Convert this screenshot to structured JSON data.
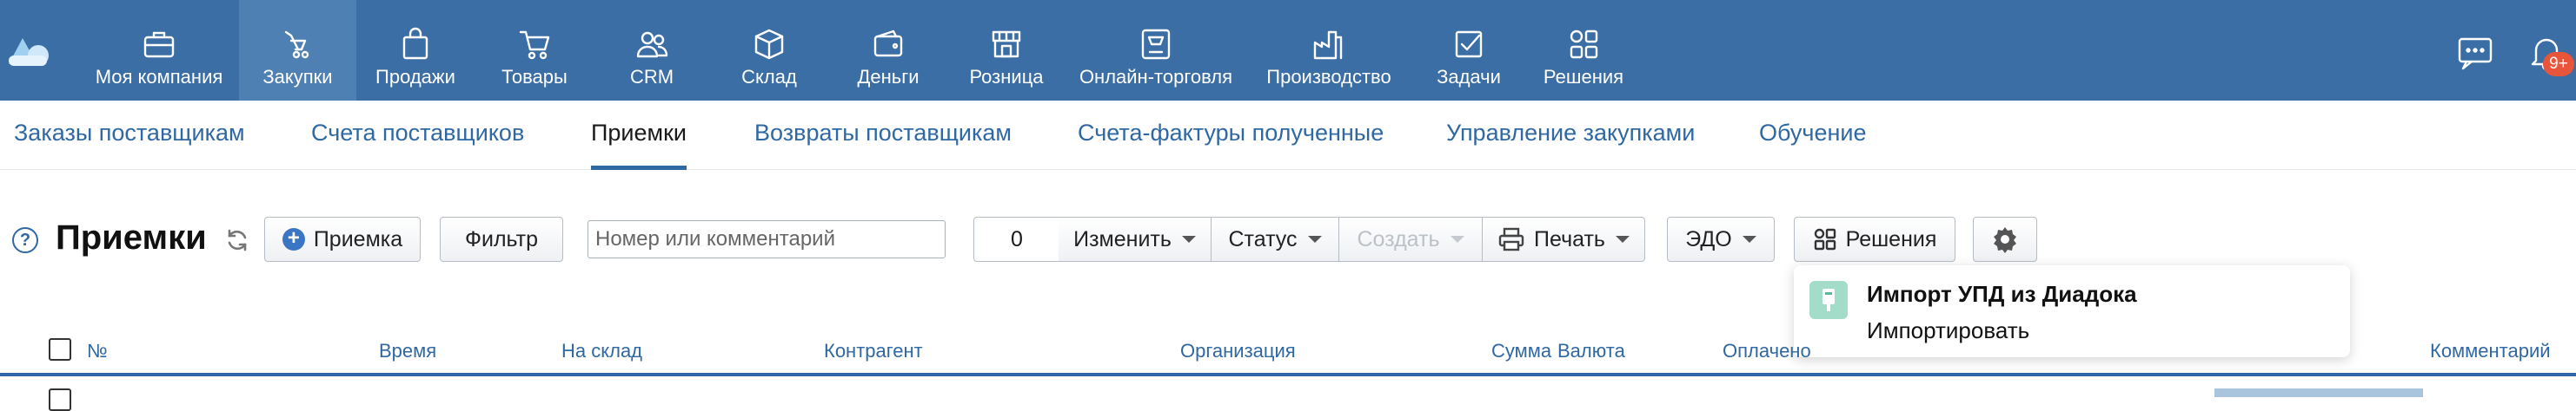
{
  "topnav": {
    "items": [
      {
        "label": "Моя компания",
        "icon": "briefcase-icon"
      },
      {
        "label": "Закупки",
        "icon": "cart-hand-icon"
      },
      {
        "label": "Продажи",
        "icon": "shopping-bag-icon"
      },
      {
        "label": "Товары",
        "icon": "shopping-cart-icon"
      },
      {
        "label": "CRM",
        "icon": "users-icon"
      },
      {
        "label": "Склад",
        "icon": "box-icon"
      },
      {
        "label": "Деньги",
        "icon": "wallet-icon"
      },
      {
        "label": "Розница",
        "icon": "store-icon"
      },
      {
        "label": "Онлайн-торговля",
        "icon": "online-store-icon"
      },
      {
        "label": "Производство",
        "icon": "factory-icon"
      },
      {
        "label": "Задачи",
        "icon": "checkbox-icon"
      },
      {
        "label": "Решения",
        "icon": "grid-icon"
      }
    ],
    "active_label": "Закупки",
    "notification_count": "9+",
    "accent": "#3b6ea5"
  },
  "subtabs": {
    "items": [
      "Заказы поставщикам",
      "Счета поставщиков",
      "Приемки",
      "Возвраты поставщикам",
      "Счета-фактуры полученные",
      "Управление закупками",
      "Обучение"
    ],
    "active": "Приемки"
  },
  "toolbar": {
    "help": "?",
    "title": "Приемки",
    "new_button": "Приемка",
    "filter_button": "Фильтр",
    "search_placeholder": "Номер или комментарий",
    "selected_count": "0",
    "change_button": "Изменить",
    "status_button": "Статус",
    "create_button": "Создать",
    "print_button": "Печать",
    "edo_button": "ЭДО",
    "solutions_button": "Решения"
  },
  "popup": {
    "title": "Импорт УПД из Диадока",
    "action": "Импортировать"
  },
  "table": {
    "columns": [
      "№",
      "Время",
      "На склад",
      "Контрагент",
      "Организация",
      "Сумма",
      "Валюта",
      "Оплачено",
      "Комментарий"
    ]
  }
}
